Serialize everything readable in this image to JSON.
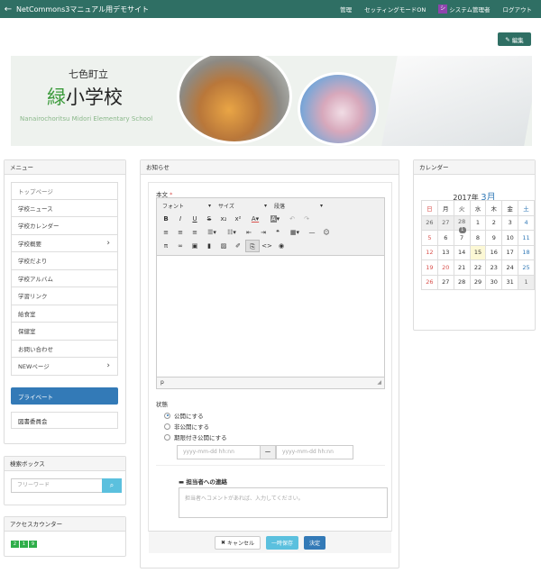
{
  "topbar": {
    "site_title": "NetCommons3マニュアル用デモサイト",
    "manage": "管理",
    "setting_mode": "セッティングモードON",
    "avatar_text": "シ",
    "user": "システム管理者",
    "logout": "ログアウト",
    "bg_color": "#2f6f64"
  },
  "edit_button": {
    "label": "編集"
  },
  "banner": {
    "line1": "七色町立",
    "line2_green": "緑",
    "line2_rest": "小学校",
    "line3": "Nanairochoritsu Midori Elementary School"
  },
  "menu_panel": {
    "title": "メニュー",
    "items": [
      {
        "label": "トップページ"
      },
      {
        "label": "学校ニュース"
      },
      {
        "label": "学校カレンダー"
      },
      {
        "label": "学校概要",
        "arrow": "›"
      },
      {
        "label": "学校だより"
      },
      {
        "label": "学校アルバム"
      },
      {
        "label": "学習リンク"
      },
      {
        "label": "給食室"
      },
      {
        "label": "保健室"
      },
      {
        "label": "お問い合わせ"
      },
      {
        "label": "NEWページ",
        "arrow": "›"
      }
    ],
    "private": "プライベート",
    "library": "図書委員会"
  },
  "search_panel": {
    "title": "検索ボックス",
    "placeholder": "フリーワード"
  },
  "counter_panel": {
    "title": "アクセスカウンター",
    "digits": [
      "2",
      "1",
      "9"
    ]
  },
  "notice": {
    "title": "お知らせ",
    "body_label": "本文",
    "required": "*",
    "toolbar": {
      "font": "フォント",
      "size": "サイズ",
      "paragraph": "段落"
    },
    "status_path": "p",
    "status_label": "状態",
    "radios": [
      "公開にする",
      "非公開にする",
      "期限付き公開にする"
    ],
    "date_placeholder": "yyyy-mm-dd hh:nn",
    "dash": "ー",
    "note_label": "担当者への連絡",
    "note_placeholder": "担当者へコメントがあれば、入力してください。",
    "buttons": {
      "cancel": "キャンセル",
      "temp_save": "一時保存",
      "decide": "決定"
    }
  },
  "calendar": {
    "title": "カレンダー",
    "year": "2017年",
    "month": "3月",
    "weekdays": [
      "日",
      "月",
      "火",
      "水",
      "木",
      "金",
      "土"
    ],
    "weeks": [
      [
        "26",
        "27",
        "28",
        "1",
        "2",
        "3",
        "4"
      ],
      [
        "5",
        "6",
        "7",
        "8",
        "9",
        "10",
        "11"
      ],
      [
        "12",
        "13",
        "14",
        "15",
        "16",
        "17",
        "18"
      ],
      [
        "19",
        "20",
        "21",
        "22",
        "23",
        "24",
        "25"
      ],
      [
        "26",
        "27",
        "28",
        "29",
        "30",
        "31",
        "1"
      ]
    ],
    "badge_count": "1"
  }
}
